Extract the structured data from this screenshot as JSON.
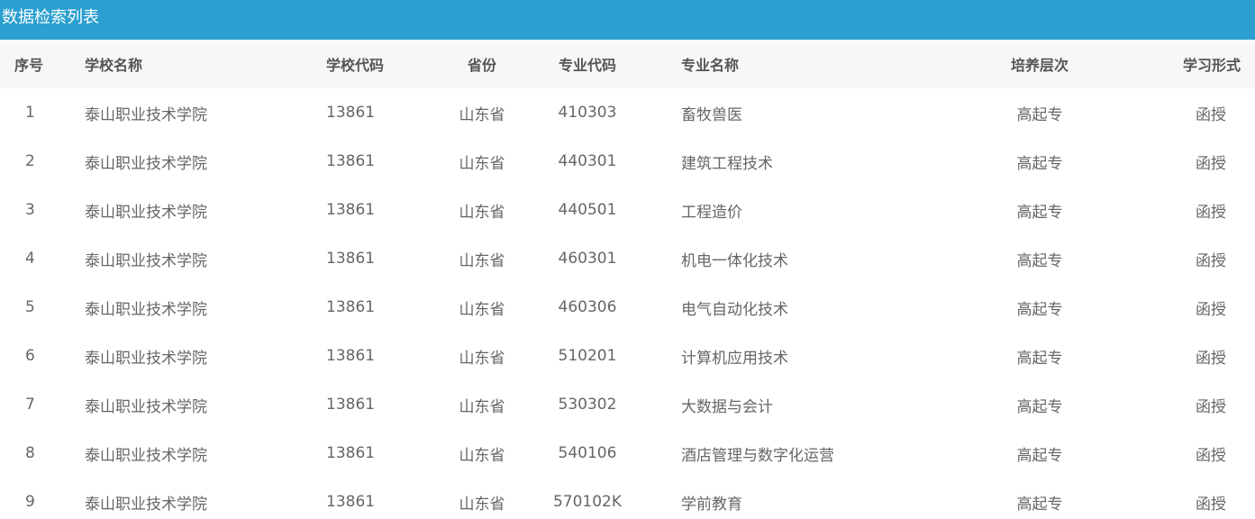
{
  "panel": {
    "title": "数据检索列表"
  },
  "table": {
    "headers": {
      "index": "序号",
      "school_name": "学校名称",
      "school_code": "学校代码",
      "province": "省份",
      "major_code": "专业代码",
      "major_name": "专业名称",
      "level": "培养层次",
      "study_form": "学习形式"
    },
    "rows": [
      {
        "index": "1",
        "school_name": "泰山职业技术学院",
        "school_code": "13861",
        "province": "山东省",
        "major_code": "410303",
        "major_name": "畜牧兽医",
        "level": "高起专",
        "study_form": "函授"
      },
      {
        "index": "2",
        "school_name": "泰山职业技术学院",
        "school_code": "13861",
        "province": "山东省",
        "major_code": "440301",
        "major_name": "建筑工程技术",
        "level": "高起专",
        "study_form": "函授"
      },
      {
        "index": "3",
        "school_name": "泰山职业技术学院",
        "school_code": "13861",
        "province": "山东省",
        "major_code": "440501",
        "major_name": "工程造价",
        "level": "高起专",
        "study_form": "函授"
      },
      {
        "index": "4",
        "school_name": "泰山职业技术学院",
        "school_code": "13861",
        "province": "山东省",
        "major_code": "460301",
        "major_name": "机电一体化技术",
        "level": "高起专",
        "study_form": "函授"
      },
      {
        "index": "5",
        "school_name": "泰山职业技术学院",
        "school_code": "13861",
        "province": "山东省",
        "major_code": "460306",
        "major_name": "电气自动化技术",
        "level": "高起专",
        "study_form": "函授"
      },
      {
        "index": "6",
        "school_name": "泰山职业技术学院",
        "school_code": "13861",
        "province": "山东省",
        "major_code": "510201",
        "major_name": "计算机应用技术",
        "level": "高起专",
        "study_form": "函授"
      },
      {
        "index": "7",
        "school_name": "泰山职业技术学院",
        "school_code": "13861",
        "province": "山东省",
        "major_code": "530302",
        "major_name": "大数据与会计",
        "level": "高起专",
        "study_form": "函授"
      },
      {
        "index": "8",
        "school_name": "泰山职业技术学院",
        "school_code": "13861",
        "province": "山东省",
        "major_code": "540106",
        "major_name": "酒店管理与数字化运营",
        "level": "高起专",
        "study_form": "函授"
      },
      {
        "index": "9",
        "school_name": "泰山职业技术学院",
        "school_code": "13861",
        "province": "山东省",
        "major_code": "570102K",
        "major_name": "学前教育",
        "level": "高起专",
        "study_form": "函授"
      }
    ]
  },
  "colors": {
    "title_bar": "#2a9fd0",
    "header_row_bg": "#f7f7f7",
    "header_text": "#555555",
    "cell_text": "#666666"
  }
}
